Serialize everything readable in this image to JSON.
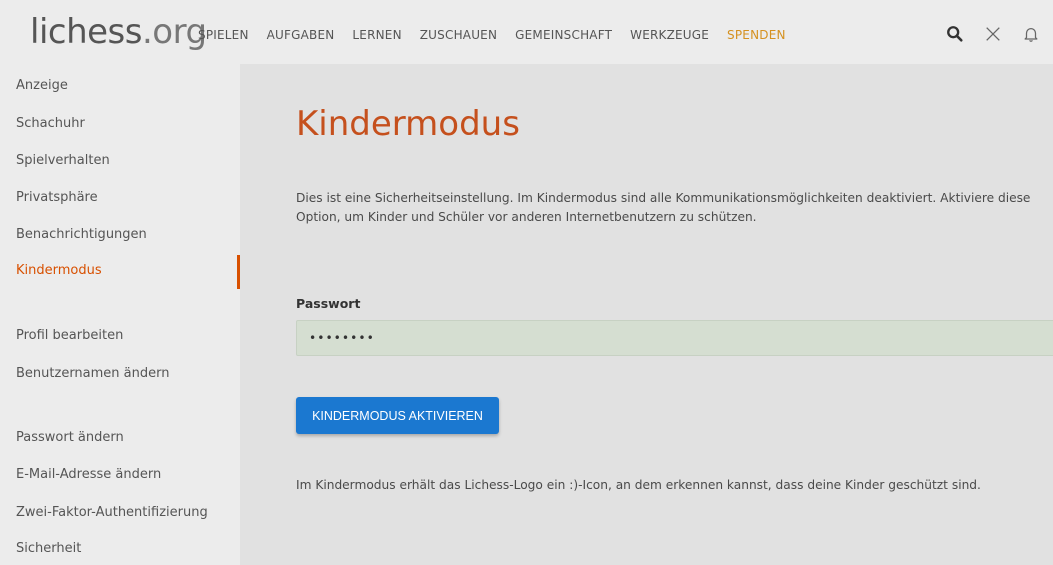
{
  "header": {
    "logo_main": "lichess",
    "logo_tld": ".org",
    "nav": [
      {
        "label": "SPIELEN"
      },
      {
        "label": "AUFGABEN"
      },
      {
        "label": "LERNEN"
      },
      {
        "label": "ZUSCHAUEN"
      },
      {
        "label": "GEMEINSCHAFT"
      },
      {
        "label": "WERKZEUGE"
      },
      {
        "label": "SPENDEN"
      }
    ],
    "icons": [
      "search-icon",
      "swords-icon",
      "bell-icon"
    ],
    "donate_color": "#d59120"
  },
  "sidebar": {
    "items": [
      {
        "label": "Anzeige"
      },
      {
        "label": "Schachuhr"
      },
      {
        "label": "Spielverhalten"
      },
      {
        "label": "Privatsphäre"
      },
      {
        "label": "Benachrichtigungen"
      },
      {
        "label": "Kindermodus",
        "active": true
      },
      {
        "label": "Profil bearbeiten"
      },
      {
        "label": "Benutzernamen ändern"
      },
      {
        "label": "Passwort ändern"
      },
      {
        "label": "E-Mail-Adresse ändern"
      },
      {
        "label": "Zwei-Faktor-Authentifizierung"
      },
      {
        "label": "Sicherheit"
      }
    ],
    "active_color": "#d85000"
  },
  "main": {
    "title": "Kindermodus",
    "description": "Dies ist eine Sicherheitseinstellung. Im Kindermodus sind alle Kommunikationsmöglichkeiten deaktiviert. Aktiviere diese Option, um Kinder und Schüler vor anderen Internetbenutzern zu schützen.",
    "password_label": "Passwort",
    "password_value": "••••••••",
    "submit_label": "KINDERMODUS AKTIVIEREN",
    "note": "Im Kindermodus erhält das Lichess-Logo ein :)-Icon, an dem erkennen kannst, dass deine Kinder geschützt sind.",
    "title_color": "#c5501d",
    "button_color": "#1b78d0"
  }
}
